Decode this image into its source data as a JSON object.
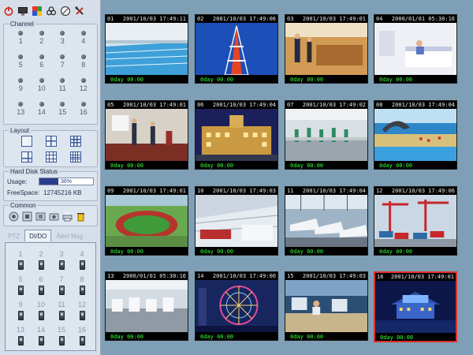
{
  "toolbar": {
    "icons": [
      "power-icon",
      "monitor-icon",
      "palette-icon",
      "biohazard-icon",
      "no-entry-icon",
      "tools-icon"
    ]
  },
  "channel": {
    "title": "Channel",
    "items": [
      "1",
      "2",
      "3",
      "4",
      "5",
      "6",
      "7",
      "8",
      "9",
      "10",
      "11",
      "12",
      "13",
      "14",
      "15",
      "16"
    ]
  },
  "layout": {
    "title": "Layout",
    "options": [
      "1",
      "4",
      "9",
      "6",
      "13",
      "16"
    ]
  },
  "hdd": {
    "title": "Hard Disk Status",
    "usage_label": "Usage:",
    "usage_percent": 36,
    "usage_text": "36%",
    "free_label": "FreeSpace:",
    "free_value": "12745216 KB"
  },
  "common": {
    "title": "Common",
    "icons": [
      "record-icon",
      "stop-icon",
      "film-icon",
      "camera-snapshot-icon",
      "printer-icon",
      "trash-icon"
    ]
  },
  "tabs": [
    {
      "label": "PTZ",
      "active": false
    },
    {
      "label": "DI/DO",
      "active": true
    },
    {
      "label": "Alert Msg",
      "active": false
    }
  ],
  "dido": {
    "items": [
      "1",
      "2",
      "3",
      "4",
      "5",
      "6",
      "7",
      "8",
      "9",
      "10",
      "11",
      "12",
      "13",
      "14",
      "15",
      "16"
    ]
  },
  "cameras": [
    {
      "id": "01",
      "timestamp": "2001/10/03 17:49:11",
      "rec": "0day 00:00",
      "scene": "pool"
    },
    {
      "id": "02",
      "timestamp": "2001/10/03 17:49:06",
      "rec": "0day 00:00",
      "scene": "tower"
    },
    {
      "id": "03",
      "timestamp": "2001/10/03 17:49:01",
      "rec": "0day 00:00",
      "scene": "office"
    },
    {
      "id": "04",
      "timestamp": "2000/01/01 05:30:16",
      "rec": "0day 00:00",
      "scene": "hospital"
    },
    {
      "id": "05",
      "timestamp": "2001/10/03 17:49:01",
      "rec": "0day 00:00",
      "scene": "meeting"
    },
    {
      "id": "06",
      "timestamp": "2001/10/03 17:49:04",
      "rec": "0day 00:00",
      "scene": "palace"
    },
    {
      "id": "07",
      "timestamp": "2001/10/03 17:49:02",
      "rec": "0day 00:00",
      "scene": "factory"
    },
    {
      "id": "08",
      "timestamp": "2001/10/03 17:49:04",
      "rec": "0day 00:00",
      "scene": "dolphin"
    },
    {
      "id": "09",
      "timestamp": "2001/10/03 17:49:01",
      "rec": "0day 00:00",
      "scene": "stadium"
    },
    {
      "id": "10",
      "timestamp": "2001/10/03 17:49:03",
      "rec": "0day 00:00",
      "scene": "terminal"
    },
    {
      "id": "11",
      "timestamp": "2001/10/03 17:49:04",
      "rec": "0day 00:00",
      "scene": "trains"
    },
    {
      "id": "12",
      "timestamp": "2001/10/03 17:49:06",
      "rec": "0day 00:00",
      "scene": "port"
    },
    {
      "id": "13",
      "timestamp": "2000/01/01 05:30:16",
      "rec": "0day 00:00",
      "scene": "lab"
    },
    {
      "id": "14",
      "timestamp": "2001/10/03 17:49:00",
      "rec": "0day 00:00",
      "scene": "ferris"
    },
    {
      "id": "15",
      "timestamp": "2001/10/03 17:49:03",
      "rec": "0day 00:00",
      "scene": "control"
    },
    {
      "id": "16",
      "timestamp": "2001/10/03 17:49:01",
      "rec": "0day 00:00",
      "scene": "night-building",
      "selected": true
    }
  ],
  "colors": {
    "accent": "#2d3d8e",
    "selected_border": "#e0302a",
    "rec_text": "#38ff38"
  }
}
